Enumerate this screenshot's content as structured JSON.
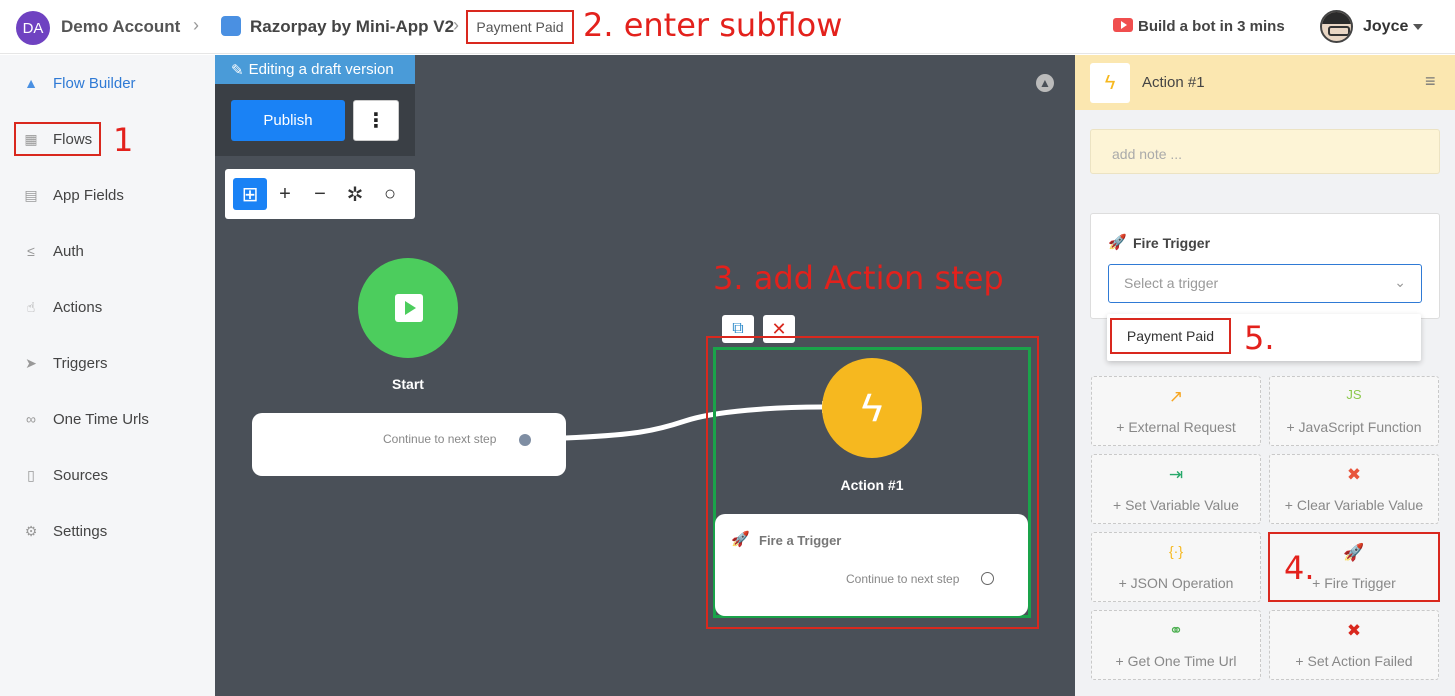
{
  "header": {
    "account_initials": "DA",
    "account_name": "Demo Account",
    "breadcrumb_sep": "›",
    "app_name": "Razorpay by Mini-App V2",
    "flow_name": "Payment Paid",
    "build_bot_label": "Build a bot in 3 mins",
    "user_name": "Joyce"
  },
  "annotations": {
    "a1": "1",
    "a2": "2. enter subflow",
    "a3": "3. add Action step",
    "a4": "4.",
    "a5": "5."
  },
  "sidebar": {
    "items": [
      {
        "label": "Flow Builder",
        "icon": "flow-builder-icon",
        "glyph": "▲"
      },
      {
        "label": "Flows",
        "icon": "grid-icon",
        "glyph": "▦"
      },
      {
        "label": "App Fields",
        "icon": "fields-icon",
        "glyph": "▤"
      },
      {
        "label": "Auth",
        "icon": "auth-icon",
        "glyph": "≤"
      },
      {
        "label": "Actions",
        "icon": "hand-pointer-icon",
        "glyph": "☝"
      },
      {
        "label": "Triggers",
        "icon": "send-icon",
        "glyph": "➤"
      },
      {
        "label": "One Time Urls",
        "icon": "link-icon",
        "glyph": "∞"
      },
      {
        "label": "Sources",
        "icon": "document-icon",
        "glyph": "▯"
      },
      {
        "label": "Settings",
        "icon": "gear-icon",
        "glyph": "⚙"
      }
    ]
  },
  "canvas": {
    "draft_label": "Editing a draft version",
    "publish_label": "Publish",
    "more_glyph": "⋮",
    "tools": {
      "folder": "⊞",
      "zoom_in": "+",
      "zoom_out": "−",
      "fit": "✲",
      "search": "○"
    },
    "start_label": "Start",
    "continue_label": "Continue to next step",
    "action_label": "Action #1",
    "action_card_title": "Fire a Trigger",
    "action_glyph": "ϟ",
    "copy_glyph": "⧉",
    "delete_glyph": "✕"
  },
  "right_panel": {
    "title": "Action #1",
    "menu_glyph": "≡",
    "note_placeholder": "add note ...",
    "fire_trigger_title": "Fire Trigger",
    "select_placeholder": "Select a trigger",
    "dropdown_option": "Payment Paid",
    "steps": [
      {
        "label": "+ External Request",
        "icon": "external-link-icon",
        "glyph": "↗",
        "color": "#f6a623"
      },
      {
        "label": "+ JavaScript Function",
        "icon": "javascript-icon",
        "glyph": "JS",
        "color": "#8cc84b"
      },
      {
        "label": "+ Set Variable Value",
        "icon": "set-variable-icon",
        "glyph": "⇥",
        "color": "#27a86a"
      },
      {
        "label": "+ Clear Variable Value",
        "icon": "clear-variable-icon",
        "glyph": "✖",
        "color": "#e8553c"
      },
      {
        "label": "+ JSON Operation",
        "icon": "json-icon",
        "glyph": "{·}",
        "color": "#f6b81f"
      },
      {
        "label": "+ Fire Trigger",
        "icon": "rocket-icon",
        "glyph": "🚀",
        "color": "#f08a1c"
      },
      {
        "label": "+ Get One Time Url",
        "icon": "link-icon",
        "glyph": "⚭",
        "color": "#4caf50"
      },
      {
        "label": "+ Set Action Failed",
        "icon": "close-icon",
        "glyph": "✖",
        "color": "#d9281e"
      }
    ]
  }
}
